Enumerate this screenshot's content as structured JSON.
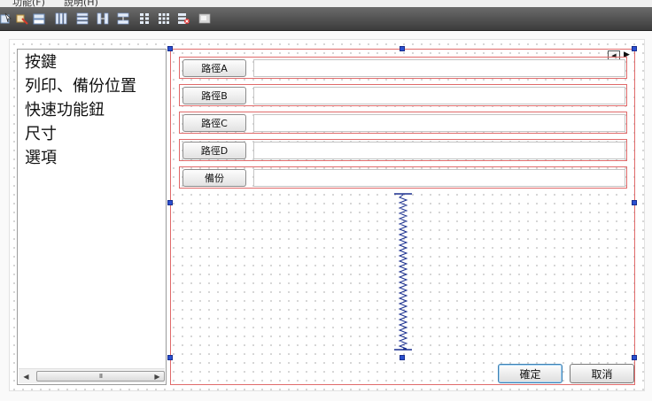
{
  "menu": [
    "功能(F)",
    "說明(H)"
  ],
  "toolbar": {
    "icons": [
      "edit-widgets-icon",
      "edit-signals-icon",
      "edit-buddies-icon",
      "layout-horizontal-icon",
      "layout-vertical-icon",
      "layout-horizontal-splitter-icon",
      "layout-vertical-splitter-icon",
      "layout-form-icon",
      "layout-grid-icon",
      "break-layout-icon",
      "adjust-size-icon"
    ]
  },
  "sidebar": {
    "items": [
      "按鍵",
      "列印、備份位置",
      "快速功能鈕",
      "尺寸",
      "選項"
    ],
    "scroll_thumb": "III"
  },
  "paths": [
    {
      "button": "路徑A",
      "value": ""
    },
    {
      "button": "路徑B",
      "value": ""
    },
    {
      "button": "路徑C",
      "value": ""
    },
    {
      "button": "路徑D",
      "value": ""
    },
    {
      "button": "備份",
      "value": ""
    }
  ],
  "footer": {
    "ok_label": "確定",
    "cancel_label": "取消"
  },
  "colors": {
    "toolbar": "#4a4a4a",
    "layout_border": "#e06a6a",
    "selection_handle": "#2a4fcf",
    "spacer": "#1a2f8f"
  }
}
